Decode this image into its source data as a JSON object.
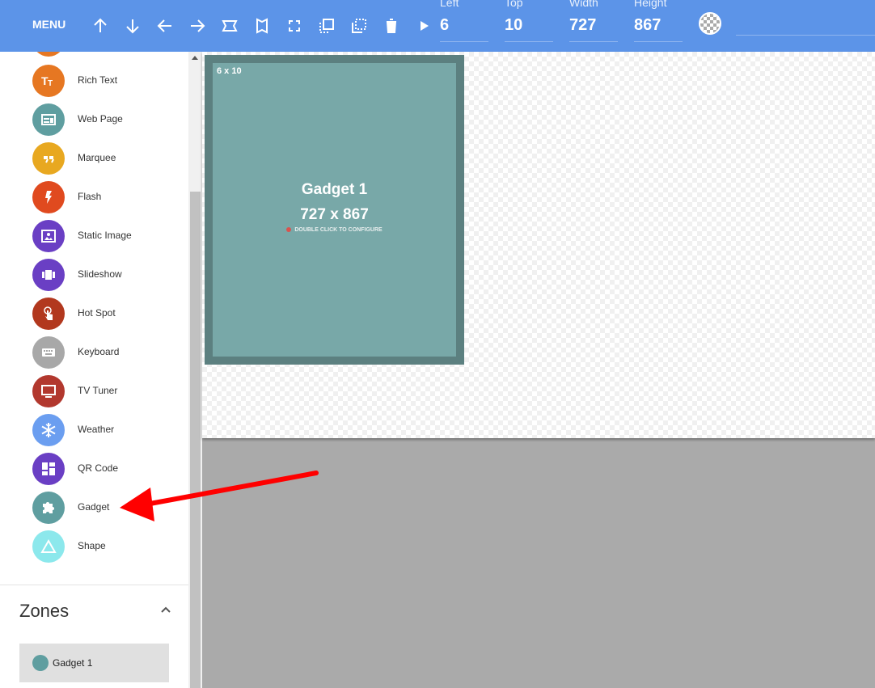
{
  "toolbar": {
    "menu_label": "MENU",
    "icons": [
      "arrow-up-icon",
      "arrow-down-icon",
      "arrow-left-icon",
      "arrow-right-icon",
      "stretch-horizontal-icon",
      "stretch-vertical-icon",
      "fullscreen-icon",
      "bring-forward-icon",
      "send-backward-icon",
      "delete-icon",
      "play-icon"
    ],
    "fields": [
      {
        "label": "Left",
        "value": "6"
      },
      {
        "label": "Top",
        "value": "10"
      },
      {
        "label": "Width",
        "value": "727"
      },
      {
        "label": "Height",
        "value": "867"
      }
    ]
  },
  "sidebar": {
    "items": [
      {
        "label": "Rich Text",
        "icon": "text-format-icon",
        "color": "#e67722"
      },
      {
        "label": "Web Page",
        "icon": "web-page-icon",
        "color": "#5f9ea0"
      },
      {
        "label": "Marquee",
        "icon": "quote-icon",
        "color": "#e8a820"
      },
      {
        "label": "Flash",
        "icon": "flash-icon",
        "color": "#e04a1f"
      },
      {
        "label": "Static Image",
        "icon": "image-icon",
        "color": "#6a3fc4"
      },
      {
        "label": "Slideshow",
        "icon": "slideshow-icon",
        "color": "#6a3fc4"
      },
      {
        "label": "Hot Spot",
        "icon": "touch-icon",
        "color": "#b2381e"
      },
      {
        "label": "Keyboard",
        "icon": "keyboard-icon",
        "color": "#a8a8a8"
      },
      {
        "label": "TV Tuner",
        "icon": "tv-icon",
        "color": "#b2382e"
      },
      {
        "label": "Weather",
        "icon": "snowflake-icon",
        "color": "#6b9ef0"
      },
      {
        "label": "QR Code",
        "icon": "qr-code-icon",
        "color": "#6a3fc4"
      },
      {
        "label": "Gadget",
        "icon": "puzzle-icon",
        "color": "#5f9ea0"
      },
      {
        "label": "Shape",
        "icon": "triangle-icon",
        "color": "#8ce8ec"
      }
    ],
    "zones_title": "Zones",
    "zones": [
      {
        "label": "Gadget 1",
        "color": "#5f9ea0"
      }
    ]
  },
  "canvas": {
    "gadget": {
      "position_label": "6 x 10",
      "name": "Gadget 1",
      "size_label": "727 x 867",
      "hint": "DOUBLE CLICK TO CONFIGURE"
    }
  },
  "colors": {
    "toolbar": "#5c94e8",
    "annotation_arrow": "#ff0000"
  }
}
